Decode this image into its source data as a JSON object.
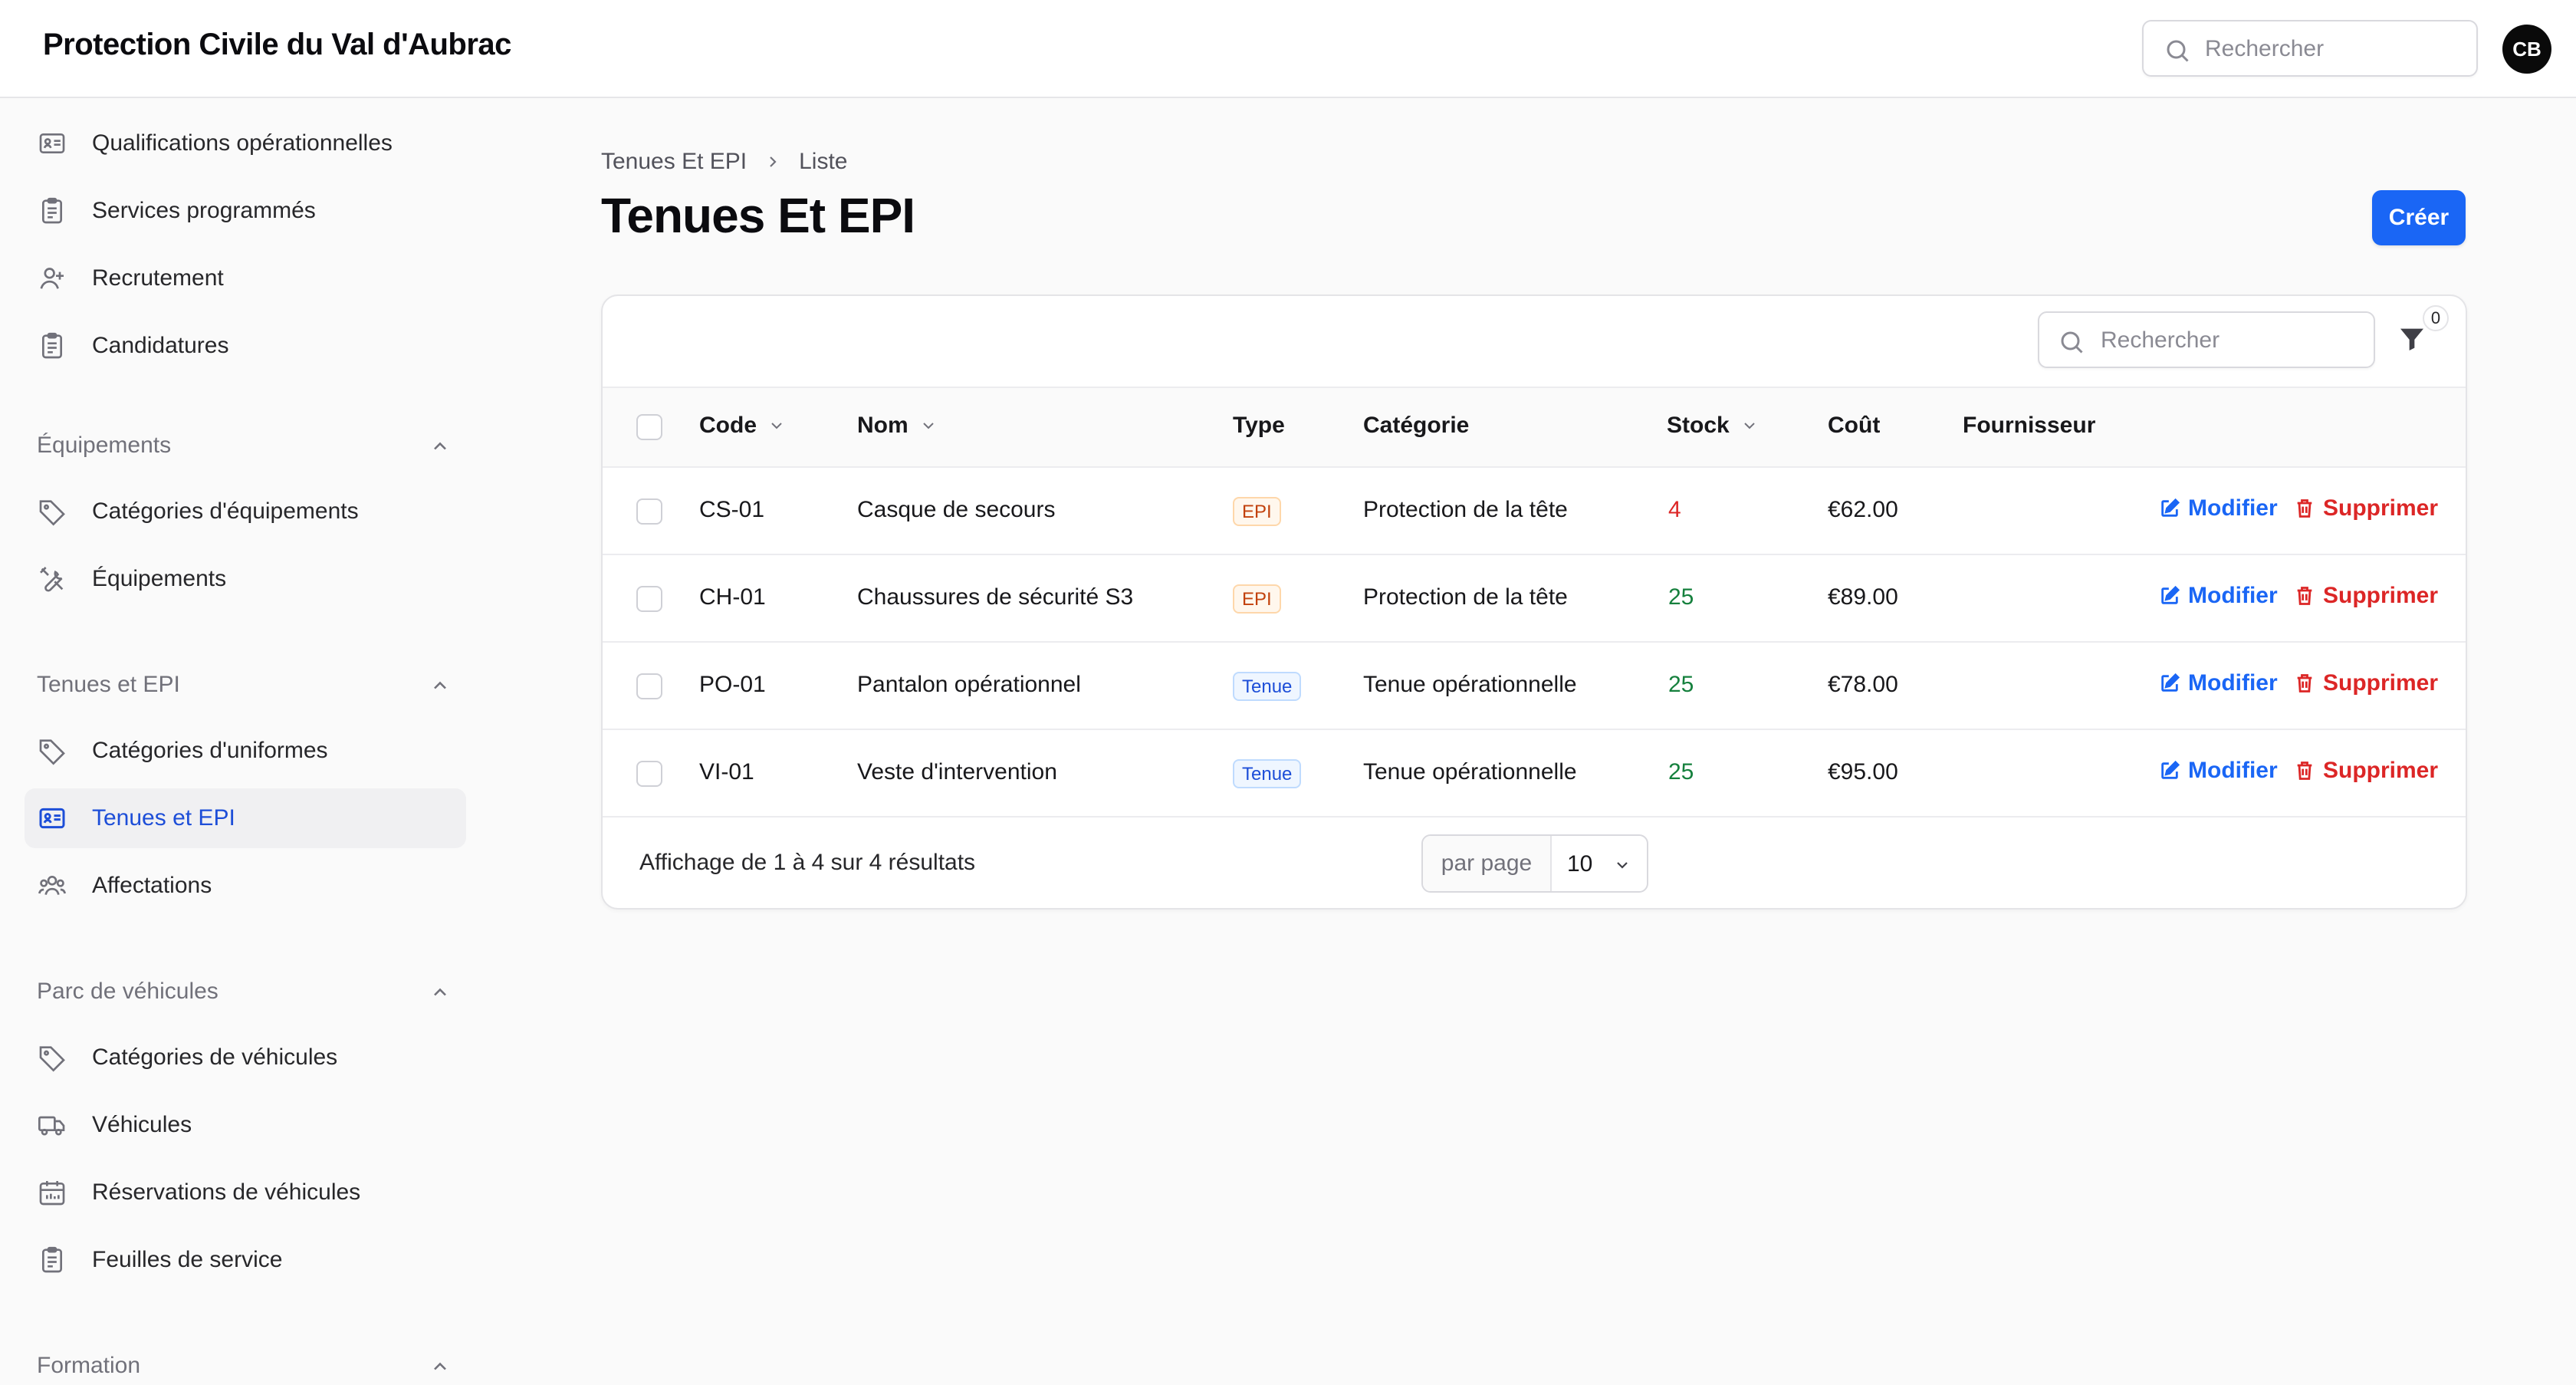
{
  "app": {
    "title": "Protection Civile du Val d'Aubrac"
  },
  "topbar": {
    "search_placeholder": "Rechercher",
    "avatar_initials": "CB"
  },
  "sidebar": {
    "items_top": [
      {
        "label": "Qualifications opérationnelles",
        "icon": "id-card-icon"
      },
      {
        "label": "Services programmés",
        "icon": "clipboard-icon"
      },
      {
        "label": "Recrutement",
        "icon": "user-plus-icon"
      },
      {
        "label": "Candidatures",
        "icon": "clipboard-icon"
      }
    ],
    "groups": [
      {
        "label": "Équipements",
        "items": [
          {
            "label": "Catégories d'équipements",
            "icon": "tag-icon"
          },
          {
            "label": "Équipements",
            "icon": "tools-icon"
          }
        ]
      },
      {
        "label": "Tenues et EPI",
        "items": [
          {
            "label": "Catégories d'uniformes",
            "icon": "tag-icon"
          },
          {
            "label": "Tenues et EPI",
            "icon": "id-card-icon",
            "active": true
          },
          {
            "label": "Affectations",
            "icon": "users-icon"
          }
        ]
      },
      {
        "label": "Parc de véhicules",
        "items": [
          {
            "label": "Catégories de véhicules",
            "icon": "tag-icon"
          },
          {
            "label": "Véhicules",
            "icon": "truck-icon"
          },
          {
            "label": "Réservations de véhicules",
            "icon": "calendar-icon"
          },
          {
            "label": "Feuilles de service",
            "icon": "clipboard-icon"
          }
        ]
      },
      {
        "label": "Formation",
        "items": []
      }
    ]
  },
  "main": {
    "breadcrumb": [
      "Tenues Et EPI",
      "Liste"
    ],
    "title": "Tenues Et EPI",
    "create_label": "Créer",
    "table": {
      "search_placeholder": "Rechercher",
      "filter_count": "0",
      "columns": [
        "Code",
        "Nom",
        "Type",
        "Catégorie",
        "Stock",
        "Coût",
        "Fournisseur"
      ],
      "rows": [
        {
          "code": "CS-01",
          "nom": "Casque de secours",
          "type": "EPI",
          "categorie": "Protection de la tête",
          "stock": "4",
          "cout": "€62.00",
          "fournisseur": ""
        },
        {
          "code": "CH-01",
          "nom": "Chaussures de sécurité S3",
          "type": "EPI",
          "categorie": "Protection de la tête",
          "stock": "25",
          "cout": "€89.00",
          "fournisseur": ""
        },
        {
          "code": "PO-01",
          "nom": "Pantalon opérationnel",
          "type": "Tenue",
          "categorie": "Tenue opérationnelle",
          "stock": "25",
          "cout": "€78.00",
          "fournisseur": ""
        },
        {
          "code": "VI-01",
          "nom": "Veste d'intervention",
          "type": "Tenue",
          "categorie": "Tenue opérationnelle",
          "stock": "25",
          "cout": "€95.00",
          "fournisseur": ""
        }
      ],
      "edit_label": "Modifier",
      "delete_label": "Supprimer",
      "footer_text": "Affichage de 1 à 4 sur 4 résultats",
      "per_page_label": "par page",
      "per_page_value": "10"
    }
  },
  "colors": {
    "primary": "#1a66f5",
    "danger": "#dc2626",
    "success": "#15803d"
  }
}
